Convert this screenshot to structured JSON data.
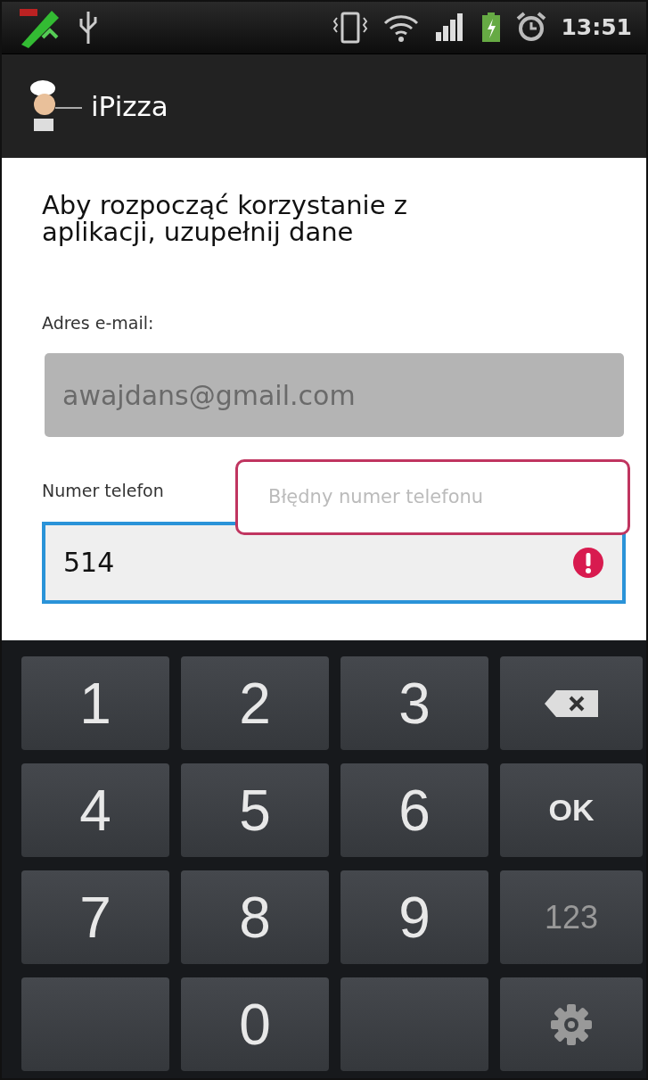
{
  "status_bar": {
    "time": "13:51"
  },
  "app_bar": {
    "title": "iPizza"
  },
  "form": {
    "heading": "Aby rozpocząć korzystanie z aplikacji, uzupełnij dane",
    "email": {
      "label": "Adres e-mail:",
      "value": "awajdans@gmail.com",
      "disabled": true
    },
    "phone": {
      "label": "Numer telefon",
      "value": "514",
      "focused": true,
      "error": "Błędny numer telefonu"
    }
  },
  "keyboard": {
    "keys": [
      {
        "kind": "digit",
        "label": "1"
      },
      {
        "kind": "digit",
        "label": "2"
      },
      {
        "kind": "digit",
        "label": "3"
      },
      {
        "kind": "backspace"
      },
      {
        "kind": "digit",
        "label": "4"
      },
      {
        "kind": "digit",
        "label": "5"
      },
      {
        "kind": "digit",
        "label": "6"
      },
      {
        "kind": "ok",
        "label": "OK"
      },
      {
        "kind": "digit",
        "label": "7"
      },
      {
        "kind": "digit",
        "label": "8"
      },
      {
        "kind": "digit",
        "label": "9"
      },
      {
        "kind": "mode",
        "label": "123"
      },
      {
        "kind": "blank"
      },
      {
        "kind": "digit",
        "label": "0"
      },
      {
        "kind": "blank"
      },
      {
        "kind": "settings"
      }
    ]
  }
}
